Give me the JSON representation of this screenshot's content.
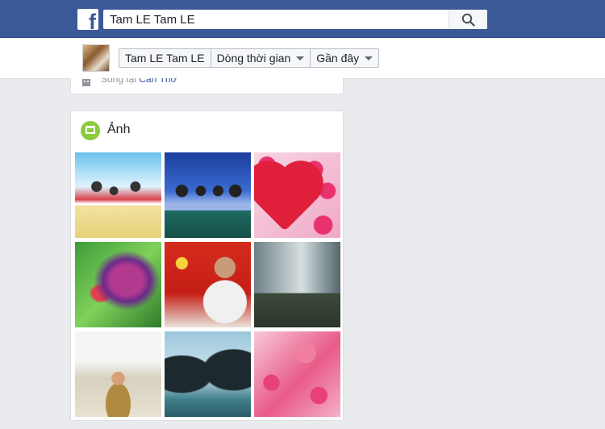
{
  "header": {
    "logo_letter": "f",
    "search": {
      "value": "Tam LE Tam LE",
      "placeholder": ""
    }
  },
  "timeline_nav": {
    "name": "Tam LE Tam LE",
    "section": "Dòng thời gian",
    "recent": "Gần đây"
  },
  "about": {
    "lives_in_prefix": "Sống tại",
    "lives_in_place": "Cần Thơ"
  },
  "photos": {
    "title": "Ảnh",
    "items": [
      {
        "desc": "photo-1"
      },
      {
        "desc": "photo-2"
      },
      {
        "desc": "photo-3"
      },
      {
        "desc": "photo-4"
      },
      {
        "desc": "photo-5"
      },
      {
        "desc": "photo-6"
      },
      {
        "desc": "photo-7"
      },
      {
        "desc": "photo-8"
      },
      {
        "desc": "photo-9"
      }
    ]
  },
  "colors": {
    "brand": "#3b5998",
    "link": "#365899",
    "photos_icon": "#8ccb3b"
  },
  "icons": [
    "facebook-logo-icon",
    "search-icon",
    "caret-down-icon",
    "home-icon",
    "photos-icon"
  ]
}
